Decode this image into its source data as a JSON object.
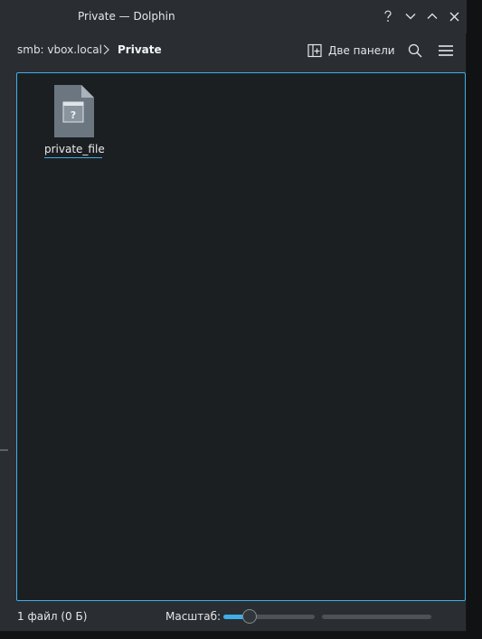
{
  "window": {
    "title": "Private — Dolphin"
  },
  "titlebar_buttons": [
    {
      "name": "help-button",
      "icon": "question-mark-icon",
      "glyph": "?"
    },
    {
      "name": "minimize-button",
      "icon": "chevron-down-icon",
      "glyph": "⌄"
    },
    {
      "name": "maximize-button",
      "icon": "chevron-up-icon",
      "glyph": "⌃"
    },
    {
      "name": "close-button",
      "icon": "close-icon",
      "glyph": "✕"
    }
  ],
  "breadcrumb": {
    "items": [
      {
        "label": "smb: vbox.local"
      },
      {
        "label": "Private"
      }
    ]
  },
  "toolbar": {
    "split_label": "Две панели",
    "split_icon": "split-view-icon",
    "search_icon": "search-icon",
    "menu_icon": "hamburger-menu-icon"
  },
  "files": [
    {
      "name": "private_file",
      "icon": "unknown-file-icon"
    }
  ],
  "statusbar": {
    "info": "1 файл (0 Б)",
    "zoom_label": "Масштаб:",
    "zoom_level_fraction": 0.29
  },
  "colors": {
    "accent": "#3daee9",
    "window_bg": "#2a2e32",
    "view_bg": "#1c1f22",
    "text": "#e4e7ea"
  }
}
